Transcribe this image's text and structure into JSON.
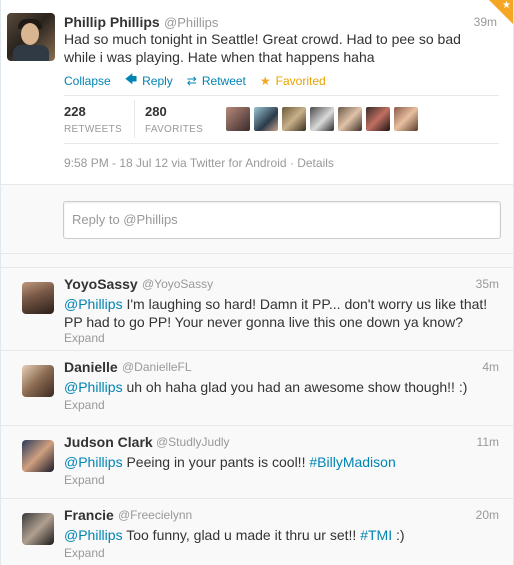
{
  "colors": {
    "link": "#0084b4",
    "favorite": "#f5a623",
    "muted": "#999999",
    "text": "#333333"
  },
  "main_tweet": {
    "name": "Phillip Phillips",
    "handle": "@Phillips",
    "time": "39m",
    "text": "Had so much tonight in Seattle! Great crowd. Had to pee so bad while i was playing. Hate when that happens haha",
    "actions": {
      "collapse": "Collapse",
      "reply": "Reply",
      "retweet": "Retweet",
      "favorited": "Favorited"
    },
    "retweets_count": "228",
    "retweets_label": "RETWEETS",
    "favorites_count": "280",
    "favorites_label": "FAVORITES",
    "meta": "9:58 PM - 18 Jul 12 via Twitter for Android · Details"
  },
  "reply_box": {
    "placeholder": "Reply to @Phillips"
  },
  "replies": [
    {
      "name": "YoyoSassy",
      "handle": "@YoyoSassy",
      "time": "35m",
      "mention": "@Phillips",
      "text": " I'm laughing so hard! Damn it PP... don't worry us like that! PP had to go PP! Your never gonna live this one down ya know?",
      "expand": "Expand"
    },
    {
      "name": "Danielle",
      "handle": "@DanielleFL",
      "time": "4m",
      "mention": "@Phillips",
      "text": " uh oh haha glad you had an awesome show though!! :)",
      "expand": "Expand"
    },
    {
      "name": "Judson Clark",
      "handle": "@StudlyJudly",
      "time": "11m",
      "mention": "@Phillips",
      "text": " Peeing in your pants is cool!! ",
      "hashtag": "#BillyMadison",
      "expand": "Expand"
    },
    {
      "name": "Francie",
      "handle": "@Freecielynn",
      "time": "20m",
      "mention": "@Phillips",
      "text": " Too funny, glad u made it thru ur set!! ",
      "hashtag": "#TMI",
      "text_end": " :)",
      "expand": "Expand"
    }
  ]
}
